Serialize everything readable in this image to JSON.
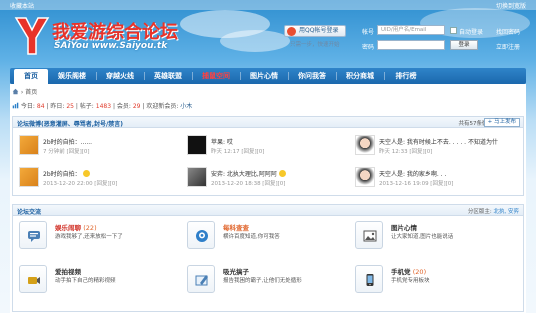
{
  "topbar": {
    "left": "收藏本站",
    "right": "切换到宽版"
  },
  "logo": {
    "title": "我爱游综合论坛",
    "subtitle": "SAiYou www.Saiyou.tk"
  },
  "login": {
    "qq_button": "用QQ帐号登录",
    "qq_hint": "只需一步，快速开始",
    "account_label": "帐号",
    "account_placeholder": "UID/用户名/Email",
    "auto_login": "自动登录",
    "forgot": "找回密码",
    "password_label": "密码",
    "login_button": "登录",
    "register": "立即注册"
  },
  "nav": {
    "items": [
      {
        "label": "首页"
      },
      {
        "label": "娱乐阁楼"
      },
      {
        "label": "穿越火线"
      },
      {
        "label": "英雄联盟"
      },
      {
        "label": "捕鼠空间"
      },
      {
        "label": "图片心情"
      },
      {
        "label": "你问我答"
      },
      {
        "label": "积分商城"
      },
      {
        "label": "排行榜"
      }
    ]
  },
  "breadcrumb": {
    "home": "首页"
  },
  "stats": {
    "today_label": "今日:",
    "today": "84",
    "yesterday_label": "昨日:",
    "yesterday": "25",
    "posts_label": "帖子:",
    "posts": "1483",
    "members_label": "会员:",
    "members": "29",
    "newest_label": "欢迎新会员:",
    "newest": "小木"
  },
  "latest": {
    "title": "论坛微博(恶意灌屏、辱骂者,封号/禁言)",
    "count_text": "共有57条微博",
    "post_button": "马上发布",
    "threads": [
      {
        "title": "2b时的自拍：......",
        "meta": "7 分钟前 [回复][0]"
      },
      {
        "title": "苹果: 哎",
        "meta": "昨天 12:17 [回复][0]"
      },
      {
        "title": "天空人是: 我有时候上不去. . . . . 不知道为什",
        "meta": "昨天 12:33 [回复][0]"
      },
      {
        "title": "2b时的自拍：",
        "meta": "2013-12-20 22:00 [回复][0]"
      },
      {
        "title": "安弈: 北执大理比,阿阿阿",
        "meta": "2013-12-20 18:38 [回复][0]"
      },
      {
        "title": "天空人是: 我的家乡啊. . .",
        "meta": "2013-12-16 19:09 [回复][0]"
      }
    ]
  },
  "forums": {
    "title": "论坛交流",
    "moderator_label": "分区版主:",
    "moderators": "北执, 安弈",
    "items": [
      {
        "name": "娱乐闹聊",
        "count": "(22)",
        "desc": "游戏我够了,还来放松一下了",
        "color": "#d2342a"
      },
      {
        "name": "每科查查",
        "count": "",
        "desc": "横许百度知道,你可我答",
        "color": "#e0642a"
      },
      {
        "name": "图片心情",
        "count": "",
        "desc": "让大家知道,图片也能说话",
        "color": "#333333"
      },
      {
        "name": "爱拍视频",
        "count": "",
        "desc": "动手拍下自己的精彩视频",
        "color": "#333333"
      },
      {
        "name": "吸光搞子",
        "count": "",
        "desc": "报告我困的霸子,让他们无处循形",
        "color": "#333333"
      },
      {
        "name": "手机党",
        "count": "(20)",
        "desc": "手机党专用板块",
        "color": "#333333"
      }
    ]
  },
  "colors": {
    "accent": "#1b68ad",
    "brand_red": "#e8332a",
    "nav_highlight": "#ff4141"
  }
}
